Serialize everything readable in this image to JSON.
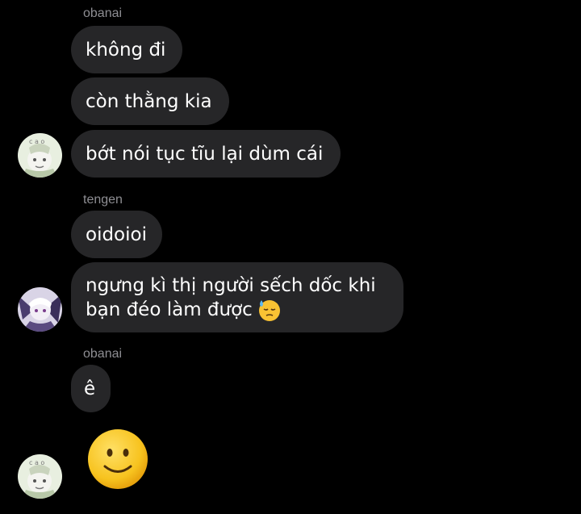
{
  "messages": [
    {
      "sender": "obanai",
      "texts": [
        "không đi",
        "còn thằng kia",
        "bớt nói tục tĩu lại dùm cái"
      ]
    },
    {
      "sender": "tengen",
      "texts": [
        "oidoioi"
      ],
      "multiline_lines": [
        "ngưng kì thị người sếch dốc khi",
        "bạn đéo làm được"
      ],
      "emoji": "downcast-sweat-face"
    },
    {
      "sender": "obanai",
      "texts": [
        "ê"
      ],
      "big_emoji": "slightly-smiling-face"
    }
  ],
  "colors": {
    "background": "#000000",
    "bubble": "#262628",
    "sender_label": "#8e8e93",
    "text": "#ffffff"
  }
}
